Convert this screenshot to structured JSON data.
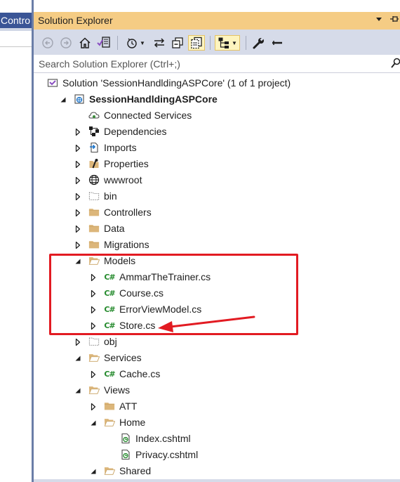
{
  "left_panel": {
    "tab_label": "Contro"
  },
  "window": {
    "title": "Solution Explorer"
  },
  "search": {
    "placeholder": "Search Solution Explorer (Ctrl+;)"
  },
  "tree": [
    {
      "label": "Solution 'SessionHandldingASPCore' (1 of 1 project)",
      "icon": "solution-icon",
      "level": 0,
      "expander": "none",
      "bold": false
    },
    {
      "label": "SessionHandldingASPCore",
      "icon": "web-project-icon",
      "level": 0,
      "expander": "expanded",
      "bold": true
    },
    {
      "label": "Connected Services",
      "icon": "connected-services-icon",
      "level": 1,
      "expander": "none",
      "bold": false
    },
    {
      "label": "Dependencies",
      "icon": "dependencies-icon",
      "level": 1,
      "expander": "collapsed",
      "bold": false
    },
    {
      "label": "Imports",
      "icon": "imports-icon",
      "level": 1,
      "expander": "collapsed",
      "bold": false
    },
    {
      "label": "Properties",
      "icon": "properties-icon",
      "level": 1,
      "expander": "collapsed",
      "bold": false
    },
    {
      "label": "wwwroot",
      "icon": "globe-icon",
      "level": 1,
      "expander": "collapsed",
      "bold": false
    },
    {
      "label": "bin",
      "icon": "dashed-folder-icon",
      "level": 1,
      "expander": "collapsed",
      "bold": false
    },
    {
      "label": "Controllers",
      "icon": "folder-icon",
      "level": 1,
      "expander": "collapsed",
      "bold": false
    },
    {
      "label": "Data",
      "icon": "folder-icon",
      "level": 1,
      "expander": "collapsed",
      "bold": false
    },
    {
      "label": "Migrations",
      "icon": "folder-icon",
      "level": 1,
      "expander": "collapsed",
      "bold": false
    },
    {
      "label": "Models",
      "icon": "open-folder-icon",
      "level": 1,
      "expander": "expanded",
      "bold": false
    },
    {
      "label": "AmmarTheTrainer.cs",
      "icon": "csharp-file-icon",
      "level": 2,
      "expander": "collapsed",
      "bold": false
    },
    {
      "label": "Course.cs",
      "icon": "csharp-file-icon",
      "level": 2,
      "expander": "collapsed",
      "bold": false
    },
    {
      "label": "ErrorViewModel.cs",
      "icon": "csharp-file-icon",
      "level": 2,
      "expander": "collapsed",
      "bold": false
    },
    {
      "label": "Store.cs",
      "icon": "csharp-file-icon",
      "level": 2,
      "expander": "collapsed",
      "bold": false
    },
    {
      "label": "obj",
      "icon": "dashed-folder-icon",
      "level": 1,
      "expander": "collapsed",
      "bold": false
    },
    {
      "label": "Services",
      "icon": "open-folder-icon",
      "level": 1,
      "expander": "expanded",
      "bold": false
    },
    {
      "label": "Cache.cs",
      "icon": "csharp-file-icon",
      "level": 2,
      "expander": "collapsed",
      "bold": false
    },
    {
      "label": "Views",
      "icon": "open-folder-icon",
      "level": 1,
      "expander": "expanded",
      "bold": false
    },
    {
      "label": "ATT",
      "icon": "folder-icon",
      "level": 2,
      "expander": "collapsed",
      "bold": false
    },
    {
      "label": "Home",
      "icon": "open-folder-icon",
      "level": 2,
      "expander": "expanded",
      "bold": false
    },
    {
      "label": "Index.cshtml",
      "icon": "cshtml-file-icon",
      "level": 3,
      "expander": "none",
      "bold": false
    },
    {
      "label": "Privacy.cshtml",
      "icon": "cshtml-file-icon",
      "level": 3,
      "expander": "none",
      "bold": false
    },
    {
      "label": "Shared",
      "icon": "open-folder-icon",
      "level": 2,
      "expander": "expanded",
      "bold": false
    }
  ],
  "colors": {
    "accent_tab": "#3a5596",
    "title_bar": "#f5cc84",
    "toolbar": "#d6dbe9",
    "folder": "#dcb67a",
    "csharp": "#248a2c",
    "annotation": "#e21b22"
  }
}
